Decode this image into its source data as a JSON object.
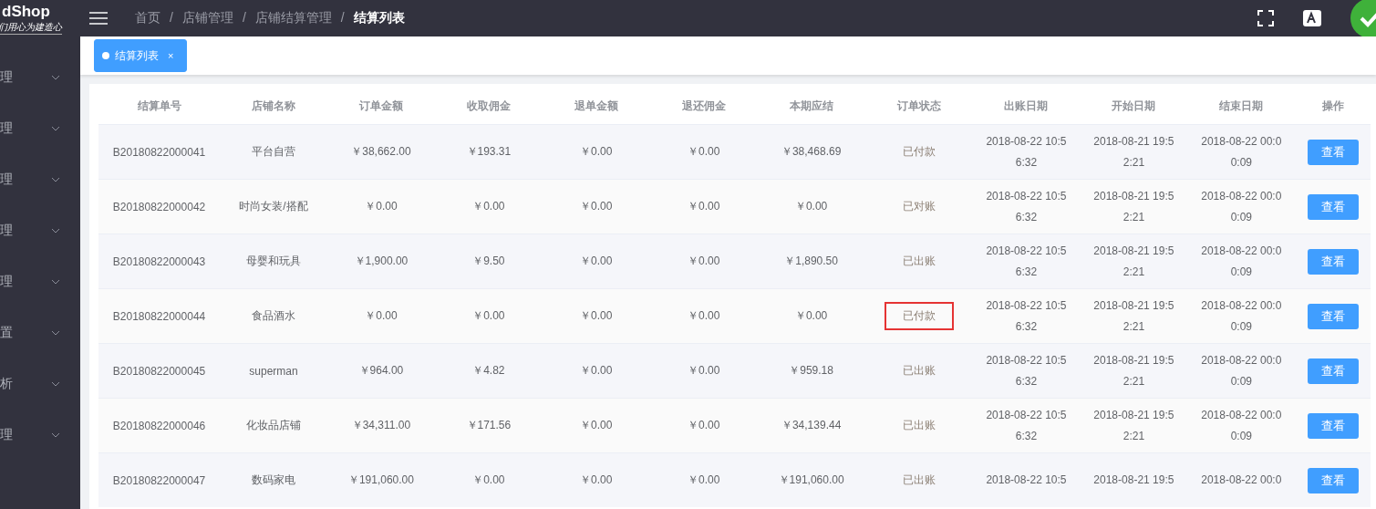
{
  "logo": {
    "name": "dShop",
    "slogan": "们用心为建造心"
  },
  "breadcrumb": {
    "separator": "/",
    "items": [
      "首页",
      "店铺管理",
      "店铺结算管理",
      "结算列表"
    ]
  },
  "sidebar": {
    "items": [
      {
        "label": "理"
      },
      {
        "label": "理"
      },
      {
        "label": "理"
      },
      {
        "label": "理"
      },
      {
        "label": "理"
      },
      {
        "label": "置"
      },
      {
        "label": "析"
      },
      {
        "label": "理"
      }
    ]
  },
  "tabs": [
    {
      "label": "结算列表",
      "close": "×",
      "selected": true
    }
  ],
  "table": {
    "columns": [
      "结算单号",
      "店铺名称",
      "订单金额",
      "收取佣金",
      "退单金额",
      "退还佣金",
      "本期应结",
      "订单状态",
      "出账日期",
      "开始日期",
      "结束日期",
      "操作"
    ],
    "rows": [
      {
        "id": "B20180822000041",
        "store": "平台自营",
        "order": "￥38,662.00",
        "commission": "￥193.31",
        "refund": "￥0.00",
        "refund_commission": "￥0.00",
        "payable": "￥38,468.69",
        "status": "已付款",
        "highlighted": false,
        "billed": [
          "2018-08-22 10:5",
          "6:32"
        ],
        "start": [
          "2018-08-21 19:5",
          "2:21"
        ],
        "end": [
          "2018-08-22 00:0",
          "0:09"
        ],
        "action": "查看"
      },
      {
        "id": "B20180822000042",
        "store": "时尚女装/搭配",
        "order": "￥0.00",
        "commission": "￥0.00",
        "refund": "￥0.00",
        "refund_commission": "￥0.00",
        "payable": "￥0.00",
        "status": "已对账",
        "highlighted": false,
        "billed": [
          "2018-08-22 10:5",
          "6:32"
        ],
        "start": [
          "2018-08-21 19:5",
          "2:21"
        ],
        "end": [
          "2018-08-22 00:0",
          "0:09"
        ],
        "action": "查看"
      },
      {
        "id": "B20180822000043",
        "store": "母婴和玩具",
        "order": "￥1,900.00",
        "commission": "￥9.50",
        "refund": "￥0.00",
        "refund_commission": "￥0.00",
        "payable": "￥1,890.50",
        "status": "已出账",
        "highlighted": false,
        "billed": [
          "2018-08-22 10:5",
          "6:32"
        ],
        "start": [
          "2018-08-21 19:5",
          "2:21"
        ],
        "end": [
          "2018-08-22 00:0",
          "0:09"
        ],
        "action": "查看"
      },
      {
        "id": "B20180822000044",
        "store": "食品酒水",
        "order": "￥0.00",
        "commission": "￥0.00",
        "refund": "￥0.00",
        "refund_commission": "￥0.00",
        "payable": "￥0.00",
        "status": "已付款",
        "highlighted": true,
        "billed": [
          "2018-08-22 10:5",
          "6:32"
        ],
        "start": [
          "2018-08-21 19:5",
          "2:21"
        ],
        "end": [
          "2018-08-22 00:0",
          "0:09"
        ],
        "action": "查看"
      },
      {
        "id": "B20180822000045",
        "store": "superman",
        "order": "￥964.00",
        "commission": "￥4.82",
        "refund": "￥0.00",
        "refund_commission": "￥0.00",
        "payable": "￥959.18",
        "status": "已出账",
        "highlighted": false,
        "billed": [
          "2018-08-22 10:5",
          "6:32"
        ],
        "start": [
          "2018-08-21 19:5",
          "2:21"
        ],
        "end": [
          "2018-08-22 00:0",
          "0:09"
        ],
        "action": "查看"
      },
      {
        "id": "B20180822000046",
        "store": "化妆品店铺",
        "order": "￥34,311.00",
        "commission": "￥171.56",
        "refund": "￥0.00",
        "refund_commission": "￥0.00",
        "payable": "￥34,139.44",
        "status": "已出账",
        "highlighted": false,
        "billed": [
          "2018-08-22 10:5",
          "6:32"
        ],
        "start": [
          "2018-08-21 19:5",
          "2:21"
        ],
        "end": [
          "2018-08-22 00:0",
          "0:09"
        ],
        "action": "查看"
      },
      {
        "id": "B20180822000047",
        "store": "数码家电",
        "order": "￥191,060.00",
        "commission": "￥0.00",
        "refund": "￥0.00",
        "refund_commission": "￥0.00",
        "payable": "￥191,060.00",
        "status": "已出账",
        "highlighted": false,
        "billed": [
          "2018-08-22 10:5"
        ],
        "start": [
          "2018-08-21 19:5"
        ],
        "end": [
          "2018-08-22 00:0"
        ],
        "action": "查看"
      }
    ]
  }
}
